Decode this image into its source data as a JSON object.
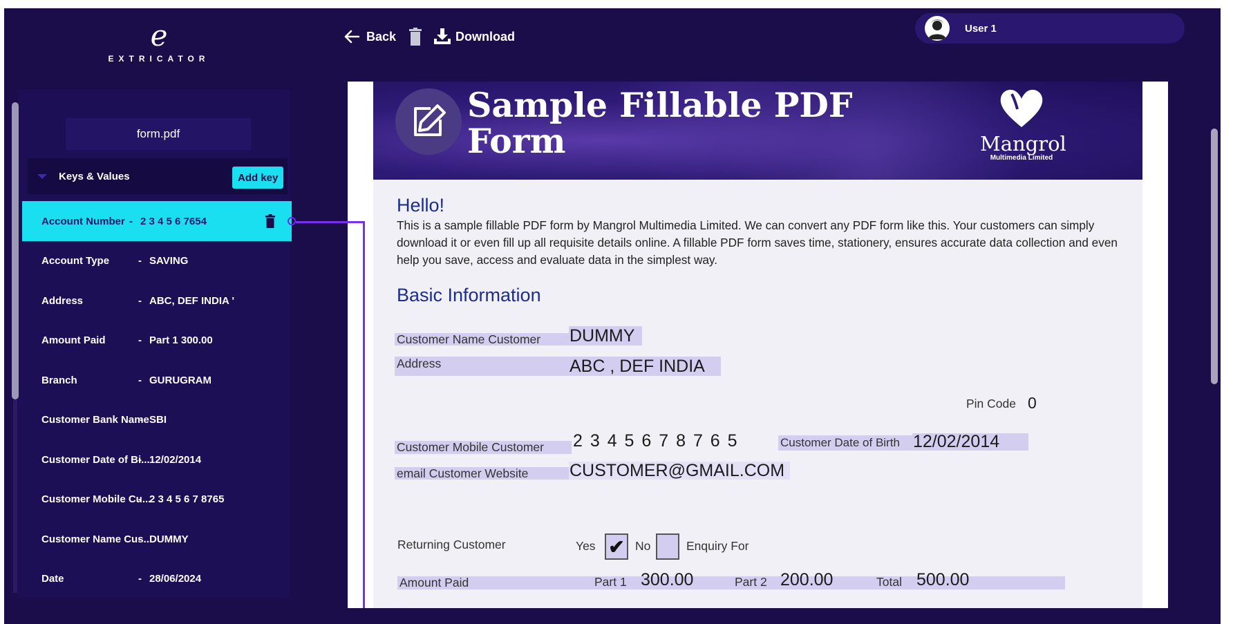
{
  "app": {
    "logo_mark": "e",
    "logo_text": "EXTRICATOR"
  },
  "toolbar": {
    "back_label": "Back",
    "download_label": "Download"
  },
  "user": {
    "name": "User 1"
  },
  "panel": {
    "file_name": "form.pdf",
    "section_title": "Keys & Values",
    "add_key_label": "Add key",
    "items": [
      {
        "key": "Account Number",
        "sep": "-",
        "value": "2 3 4 5 6 7654",
        "active": true
      },
      {
        "key": "Account Type",
        "sep": "-",
        "value": "SAVING"
      },
      {
        "key": "Address",
        "sep": "-",
        "value": "ABC, DEF INDIA '"
      },
      {
        "key": "Amount Paid",
        "sep": "-",
        "value": "Part 1 300.00"
      },
      {
        "key": "Branch",
        "sep": "-",
        "value": "GURUGRAM"
      },
      {
        "key": "Customer Bank Name",
        "sep": "-",
        "value": "SBI"
      },
      {
        "key": "Customer Date of Bi...",
        "sep": "-",
        "value": "12/02/2014"
      },
      {
        "key": "Customer Mobile Cu...",
        "sep": "-",
        "value": "2 3 4 5 6 7 8765"
      },
      {
        "key": "Customer Name Cus...",
        "sep": "-",
        "value": "DUMMY"
      },
      {
        "key": "Date",
        "sep": "-",
        "value": "28/06/2024"
      }
    ]
  },
  "document": {
    "banner_title_line1": "Sample Fillable PDF",
    "banner_title_line2": "Form",
    "brand_name": "Mangrol",
    "brand_sub": "Multimedia Limited",
    "hello": "Hello!",
    "intro": "This is a sample fillable PDF form by Mangrol Multimedia Limited. We can convert any PDF form like this. Your customers can simply download it or even fill up all requisite details online. A fillable PDF form saves time, stationery, ensures accurate data collection and even help you save, access and evaluate data in the simplest way.",
    "section_basic": "Basic Information",
    "fields": {
      "customer_name_label": "Customer Name Customer",
      "customer_name_value": "DUMMY",
      "address_label": "Address",
      "address_value": "ABC , DEF INDIA",
      "pin_label": "Pin Code",
      "pin_value": "0",
      "mobile_label": "Customer Mobile  Customer",
      "mobile_value": "2 3 4 5 6 7 8 7 6 5",
      "dob_label": "Customer Date of Birth",
      "dob_value": "12/02/2014",
      "email_label": "email Customer Website",
      "email_value": "CUSTOMER@GMAIL.COM",
      "returning_label": "Returning Customer",
      "yes_label": "Yes",
      "yes_checked": "✔",
      "no_label": "No",
      "enquiry_label": "Enquiry For",
      "amount_label": "Amount Paid",
      "part1_label": "Part 1",
      "part1_value": "300.00",
      "part2_label": "Part 2",
      "part2_value": "200.00",
      "total_label": "Total",
      "total_value": "500.00"
    }
  },
  "colors": {
    "background": "#1a0d4a",
    "accent": "#19dff0",
    "connector": "#7a2ff0",
    "field_highlight": "#d3cdf0",
    "heading_blue": "#1c2e8a"
  }
}
